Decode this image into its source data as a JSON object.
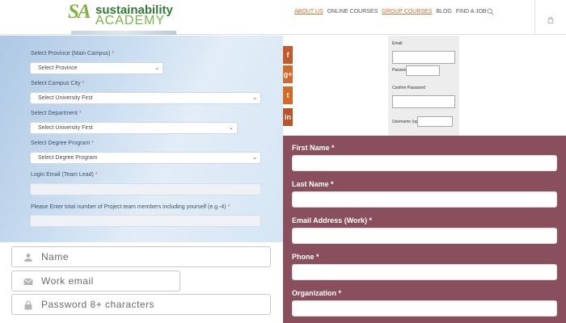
{
  "header": {
    "logo": {
      "mark": "SA",
      "name_top": "sustainability",
      "name_bottom": "ACADEMY"
    },
    "nav": [
      {
        "label": "ABOUT US",
        "style": "orange-underline"
      },
      {
        "label": "ONLINE COURSES",
        "style": "gray"
      },
      {
        "label": "GROUP COURSES",
        "style": "orange-underline"
      },
      {
        "label": "BLOG",
        "style": "gray"
      },
      {
        "label": "FIND A JOB",
        "style": "gray"
      }
    ],
    "icons": {
      "search": "search-icon",
      "cart": "shopping-bag-icon"
    }
  },
  "left_form": {
    "province": {
      "label": "Select Province (Main Campus)",
      "required": "*",
      "value": "Select Province"
    },
    "campus_city": {
      "label": "Select Campus City",
      "required": "*",
      "value": "Select University First"
    },
    "department": {
      "label": "Select Department",
      "required": "*",
      "value": "Select University First"
    },
    "degree_program": {
      "label": "Select Degree Program",
      "required": "*",
      "value": "Select Degree Program"
    },
    "login_email": {
      "label": "Login Email (Team Lead)",
      "required": "*",
      "value": ""
    },
    "team_members": {
      "label": "Please Enter total number of Project team members including yourself (e.g.-4)",
      "required": "*",
      "value": ""
    }
  },
  "bottom_inputs": {
    "name": {
      "placeholder": "Name",
      "icon": "person-icon"
    },
    "work_email": {
      "placeholder": "Work email",
      "icon": "envelope-icon"
    },
    "password": {
      "placeholder": "Password 8+ characters",
      "icon": "lock-icon"
    }
  },
  "social": [
    {
      "glyph": "f",
      "icon": "facebook-icon",
      "color": "#c45a2c"
    },
    {
      "glyph": "g+",
      "icon": "google-plus-icon",
      "color": "#d4672b"
    },
    {
      "glyph": "t",
      "icon": "twitter-icon",
      "color": "#d46a24"
    },
    {
      "glyph": "in",
      "icon": "linkedin-icon",
      "color": "#b8542a"
    }
  ],
  "mini_form": {
    "email_label": "Email",
    "password_label": "Password",
    "confirm_label": "Confirm Password",
    "username_label": "Username (optional)"
  },
  "right_form": {
    "first_name": {
      "label": "First Name *",
      "value": ""
    },
    "last_name": {
      "label": "Last Name *",
      "value": ""
    },
    "email": {
      "label": "Email Address (Work) *",
      "value": ""
    },
    "phone": {
      "label": "Phone *",
      "value": ""
    },
    "organization": {
      "label": "Organization *",
      "value": ""
    }
  },
  "colors": {
    "accent_orange": "#e06a2a",
    "brand_green": "#2e7d32",
    "panel_maroon": "#8a4f5c"
  }
}
